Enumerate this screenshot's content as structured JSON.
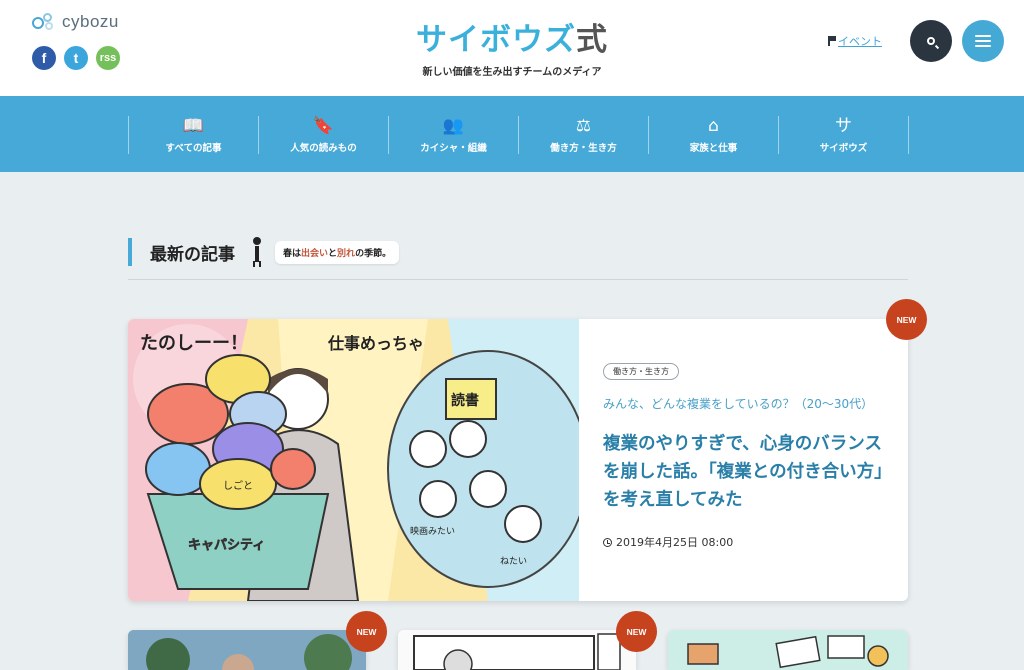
{
  "brand": {
    "name": "cybozu"
  },
  "social": {
    "facebook": "f",
    "twitter": "t",
    "rss": "rss"
  },
  "site": {
    "title_a": "サイボウズ",
    "title_b": "式",
    "subtitle": "新しい価値を生み出すチームのメディア"
  },
  "header": {
    "event_label": "イベント"
  },
  "nav": {
    "items": [
      {
        "label": "すべての記事",
        "icon": "book-icon",
        "glyph": "📖"
      },
      {
        "label": "人気の読みもの",
        "icon": "bookmark-star-icon",
        "glyph": "🔖"
      },
      {
        "label": "カイシャ・組織",
        "icon": "people-icon",
        "glyph": "👥"
      },
      {
        "label": "働き方・生き方",
        "icon": "scales-icon",
        "glyph": "⚖"
      },
      {
        "label": "家族と仕事",
        "icon": "home-icon",
        "glyph": "⌂"
      },
      {
        "label": "サイボウズ",
        "icon": "sa-icon",
        "glyph": "サ"
      }
    ]
  },
  "section": {
    "title": "最新の記事",
    "bubble_pre": "春は",
    "bubble_hl1": "出会い",
    "bubble_mid": "と",
    "bubble_hl2": "別れ",
    "bubble_post": "の季節。"
  },
  "feature": {
    "tag": "働き方・生き方",
    "kicker": "みんな、どんな複業をしているの？（20〜30代）",
    "headline": "複業のやりすぎで、心身のバランスを崩した話。「複業との付き合い方」を考え直してみた",
    "date": "2019年4月25日 08:00",
    "badge": "NEW",
    "illustration_text": {
      "tanoshii": "たのしーー！",
      "shigoto_meccha": "仕事めっちゃ",
      "shigoto": "しごと",
      "dokusho": "読書",
      "capacity": "キャパシティ",
      "eiga": "映画みたい",
      "netai": "ねたい"
    }
  },
  "bottom_cards": [
    {
      "badge": "NEW"
    },
    {
      "badge": "NEW"
    },
    {
      "badge": ""
    }
  ],
  "colors": {
    "accent": "#47a9d7",
    "badge": "#c6431e",
    "dark": "#2a3540"
  }
}
